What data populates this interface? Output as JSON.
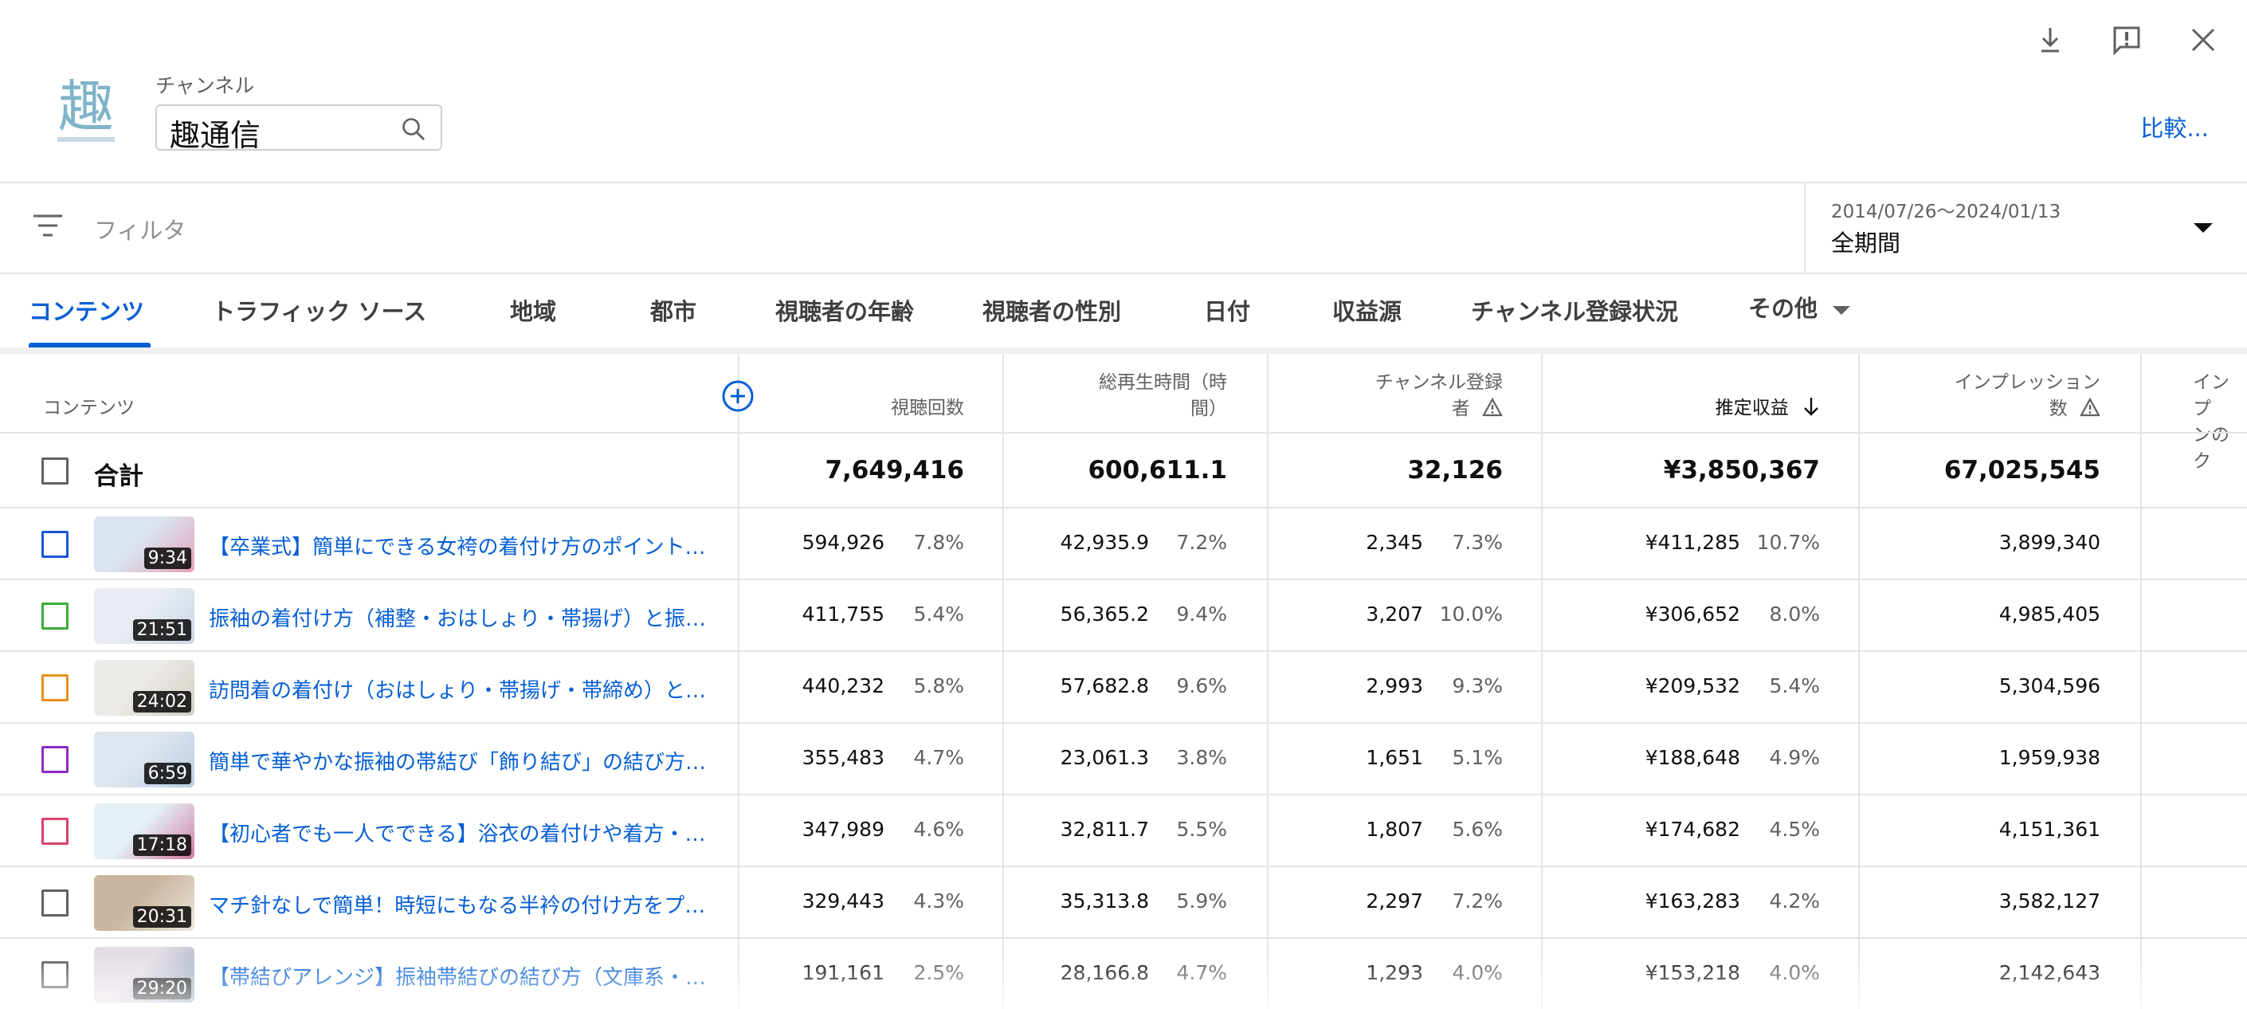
{
  "channel": {
    "label": "チャンネル",
    "name": "趣通信",
    "logo_char": "趣",
    "compare_label": "比較..."
  },
  "filter": {
    "placeholder": "フィルタ"
  },
  "date": {
    "range": "2014/07/26～2024/01/13",
    "period": "全期間"
  },
  "tabs": [
    "コンテンツ",
    "トラフィック ソース",
    "地域",
    "都市",
    "視聴者の年齢",
    "視聴者の性別",
    "日付",
    "収益源",
    "チャンネル登録状況",
    "その他"
  ],
  "columns": {
    "content": "コンテンツ",
    "views": "視聴回数",
    "watch_time_1": "総再生時間（時",
    "watch_time_2": "間）",
    "subs_1": "チャンネル登録",
    "subs_2": "者",
    "revenue": "推定収益",
    "impressions_1": "インプレッション",
    "impressions_2": "数",
    "ctr_1": "インプ",
    "ctr_2": "ンのク"
  },
  "totals": {
    "label": "合計",
    "views": "7,649,416",
    "watch_time": "600,611.1",
    "subs": "32,126",
    "revenue": "¥3,850,367",
    "impressions": "67,025,545"
  },
  "rows": [
    {
      "color": "#1a56db",
      "dur": "9:34",
      "title": "【卒業式】簡単にできる女袴の着付け方のポイントを…",
      "views": "594,926",
      "views_pct": "7.8%",
      "wt": "42,935.9",
      "wt_pct": "7.2%",
      "subs": "2,345",
      "subs_pct": "7.3%",
      "rev": "¥411,285",
      "rev_pct": "10.7%",
      "imp": "3,899,340"
    },
    {
      "color": "#3dab3a",
      "dur": "21:51",
      "title": "振袖の着付け方（補整・おはしょり・帯揚げ）と振袖…",
      "views": "411,755",
      "views_pct": "5.4%",
      "wt": "56,365.2",
      "wt_pct": "9.4%",
      "subs": "3,207",
      "subs_pct": "10.0%",
      "rev": "¥306,652",
      "rev_pct": "8.0%",
      "imp": "4,985,405"
    },
    {
      "color": "#e8911c",
      "dur": "24:02",
      "title": "訪問着の着付け（おはしょり・帯揚げ・帯締め）と袋…",
      "views": "440,232",
      "views_pct": "5.8%",
      "wt": "57,682.8",
      "wt_pct": "9.6%",
      "subs": "2,993",
      "subs_pct": "9.3%",
      "rev": "¥209,532",
      "rev_pct": "5.4%",
      "imp": "5,304,596"
    },
    {
      "color": "#8e2bc8",
      "dur": "6:59",
      "title": "簡単で華やかな振袖の帯結び「飾り結び」の結び方｜…",
      "views": "355,483",
      "views_pct": "4.7%",
      "wt": "23,061.3",
      "wt_pct": "3.8%",
      "subs": "1,651",
      "subs_pct": "5.1%",
      "rev": "¥188,648",
      "rev_pct": "4.9%",
      "imp": "1,959,938"
    },
    {
      "color": "#d6456b",
      "dur": "17:18",
      "title": "【初心者でも一人でできる】浴衣の着付けや着方・お…",
      "views": "347,989",
      "views_pct": "4.6%",
      "wt": "32,811.7",
      "wt_pct": "5.5%",
      "subs": "1,807",
      "subs_pct": "5.6%",
      "rev": "¥174,682",
      "rev_pct": "4.5%",
      "imp": "4,151,361"
    },
    {
      "color": "#606060",
      "dur": "20:31",
      "title": "マチ針なしで簡単！時短にもなる半衿の付け方をプロ…",
      "views": "329,443",
      "views_pct": "4.3%",
      "wt": "35,313.8",
      "wt_pct": "5.9%",
      "subs": "2,297",
      "subs_pct": "7.2%",
      "rev": "¥163,283",
      "rev_pct": "4.2%",
      "imp": "3,582,127"
    },
    {
      "color": "#606060",
      "dur": "29:20",
      "title": "【帯結びアレンジ】振袖帯結びの結び方（文庫系・立…",
      "views": "191,161",
      "views_pct": "2.5%",
      "wt": "28,166.8",
      "wt_pct": "4.7%",
      "subs": "1,293",
      "subs_pct": "4.0%",
      "rev": "¥153,218",
      "rev_pct": "4.0%",
      "imp": "2,142,643"
    }
  ],
  "icons": {
    "download": "download-icon",
    "feedback": "feedback-icon",
    "close": "close-icon",
    "search": "search-icon",
    "filter": "filter-icon",
    "add_column": "add-column-icon"
  },
  "colors": {
    "accent": "#065fd4",
    "text": "#0f0f0f",
    "muted": "#606060",
    "divider": "#e5e5e5"
  }
}
